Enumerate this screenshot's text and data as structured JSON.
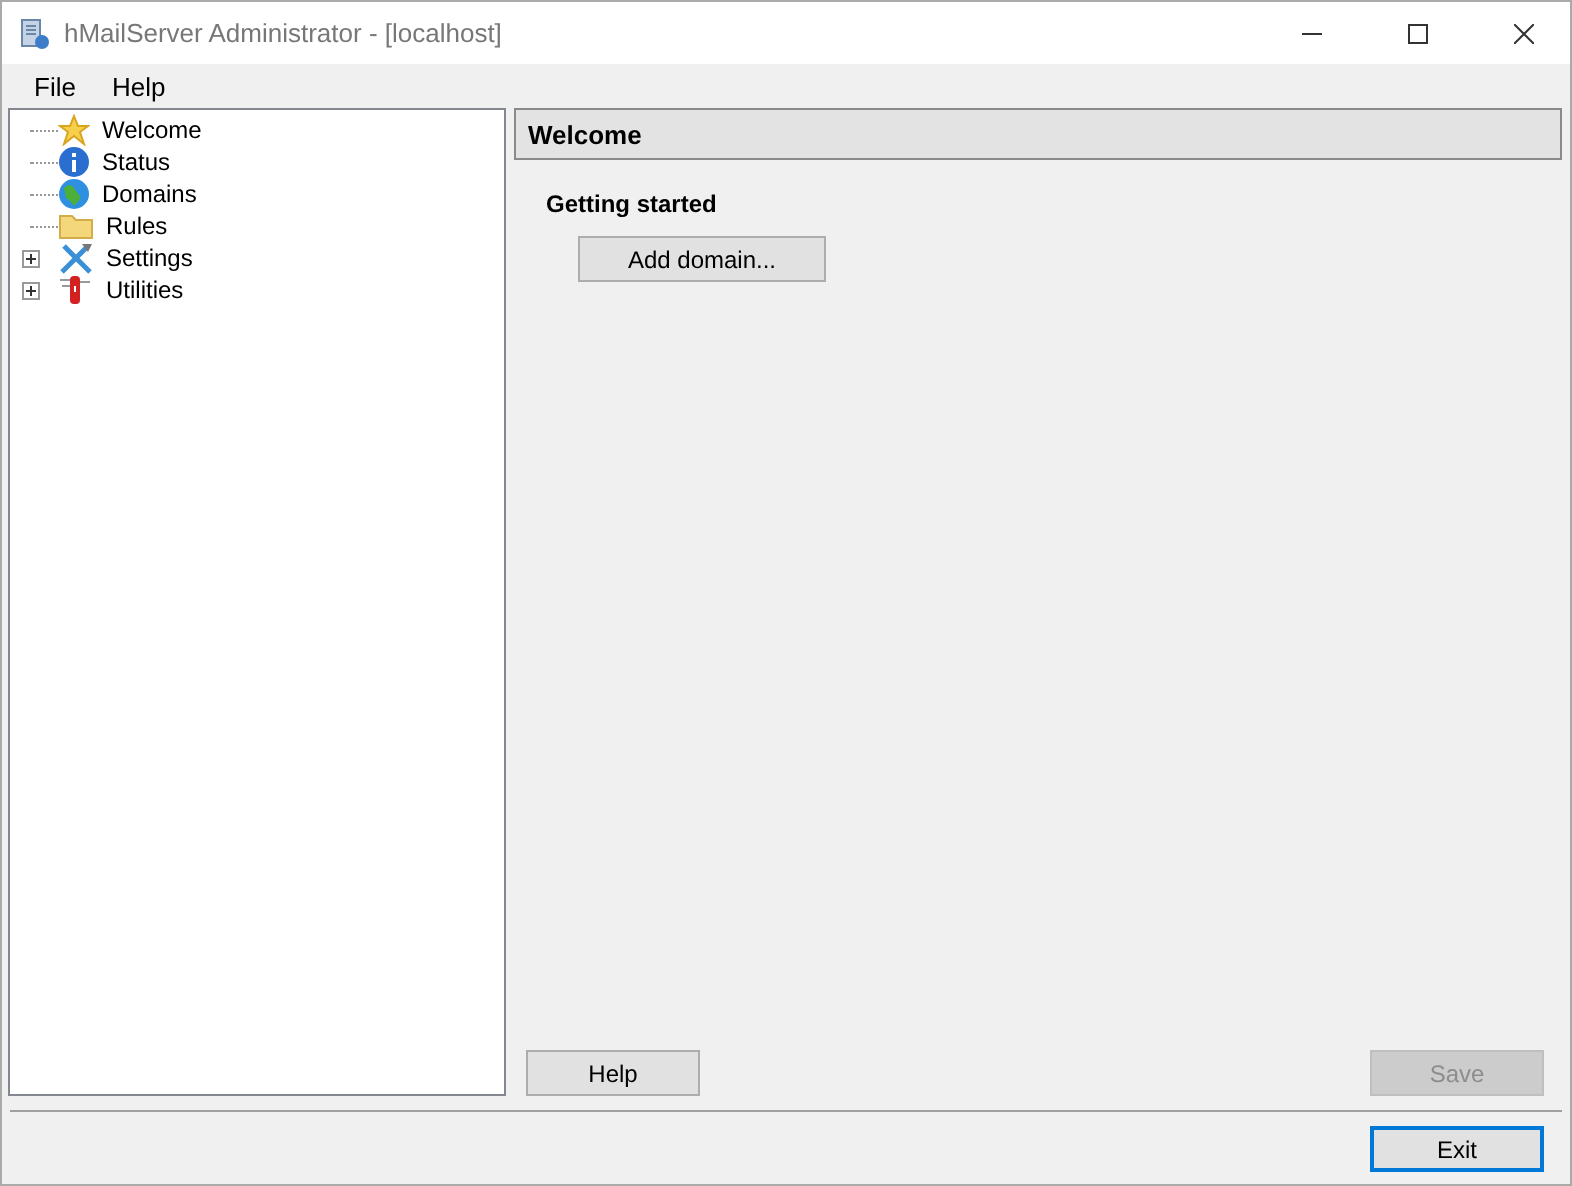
{
  "window": {
    "title": "hMailServer Administrator - [localhost]"
  },
  "menu": [
    {
      "label": "File"
    },
    {
      "label": "Help"
    }
  ],
  "tree": [
    {
      "label": "Welcome",
      "expandable": false,
      "selected": false
    },
    {
      "label": "Status",
      "expandable": false,
      "selected": false
    },
    {
      "label": "Domains",
      "expandable": false,
      "selected": false
    },
    {
      "label": "Rules",
      "expandable": false,
      "selected": false
    },
    {
      "label": "Settings",
      "expandable": true,
      "selected": false
    },
    {
      "label": "Utilities",
      "expandable": true,
      "selected": false
    }
  ],
  "panel": {
    "header": "Welcome",
    "section": "Getting started",
    "action": {
      "label": "Add domain...",
      "disabled": false
    },
    "help_button": {
      "label": "Help",
      "disabled": false
    },
    "save_button": {
      "label": "Save",
      "disabled": true
    }
  },
  "footer": {
    "exit_button": {
      "label": "Exit",
      "focused": true
    }
  }
}
